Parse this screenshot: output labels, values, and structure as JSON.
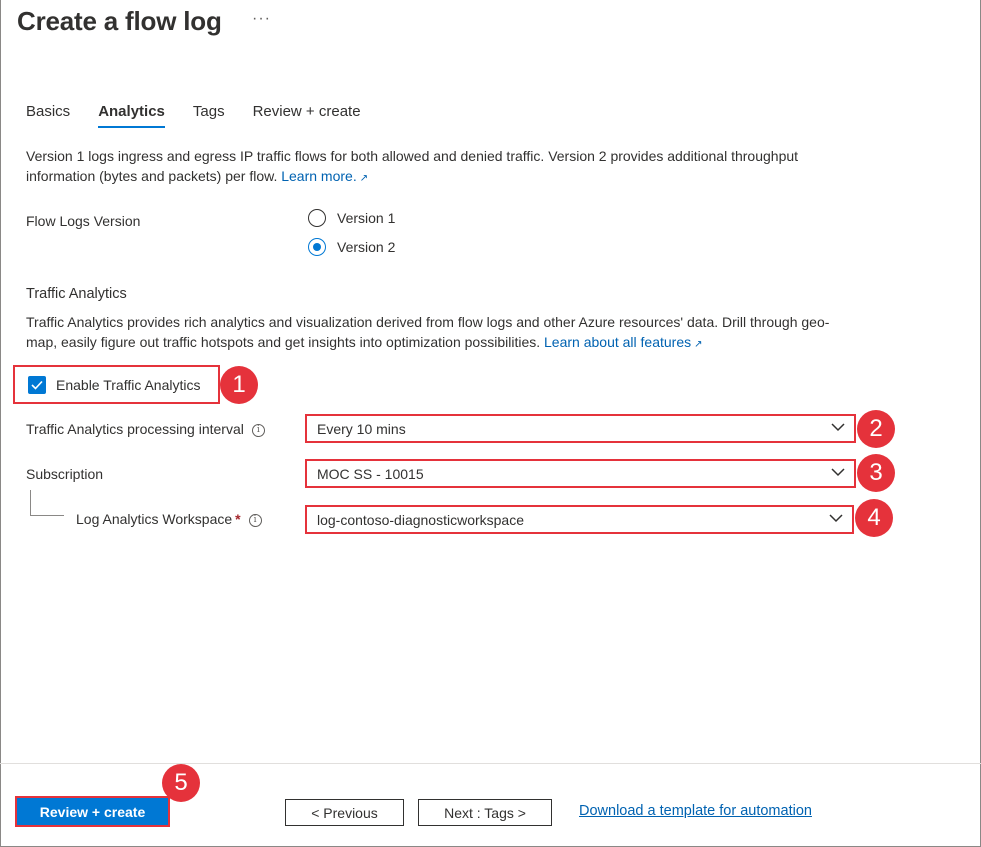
{
  "page": {
    "title": "Create a flow log",
    "more_glyph": "···"
  },
  "tabs": [
    {
      "label": "Basics",
      "active": false
    },
    {
      "label": "Analytics",
      "active": true
    },
    {
      "label": "Tags",
      "active": false
    },
    {
      "label": "Review + create",
      "active": false
    }
  ],
  "intro": {
    "text": "Version 1 logs ingress and egress IP traffic flows for both allowed and denied traffic. Version 2 provides additional throughput information (bytes and packets) per flow.",
    "link": "Learn more."
  },
  "flow_logs_version": {
    "label": "Flow Logs Version",
    "options": [
      {
        "label": "Version 1",
        "checked": false
      },
      {
        "label": "Version 2",
        "checked": true
      }
    ]
  },
  "traffic_analytics": {
    "heading": "Traffic Analytics",
    "description": "Traffic Analytics provides rich analytics and visualization derived from flow logs and other Azure resources' data. Drill through geo-map, easily figure out traffic hotspots and get insights into optimization possibilities.",
    "link": "Learn about all features",
    "enable_label": "Enable Traffic Analytics",
    "enabled": true,
    "interval_label": "Traffic Analytics processing interval",
    "interval_value": "Every 10 mins",
    "subscription_label": "Subscription",
    "subscription_value": "MOC SS - 10015",
    "workspace_label": "Log Analytics Workspace",
    "workspace_required": "*",
    "workspace_value": "log-contoso-diagnosticworkspace",
    "info_glyph": "i"
  },
  "badges": [
    "1",
    "2",
    "3",
    "4",
    "5"
  ],
  "footer": {
    "review_create": "Review + create",
    "previous": "< Previous",
    "next": "Next : Tags >",
    "download_link": "Download a template for automation"
  },
  "colors": {
    "accent": "#0078d4",
    "highlight": "#e5323b",
    "link": "#0062b1"
  }
}
